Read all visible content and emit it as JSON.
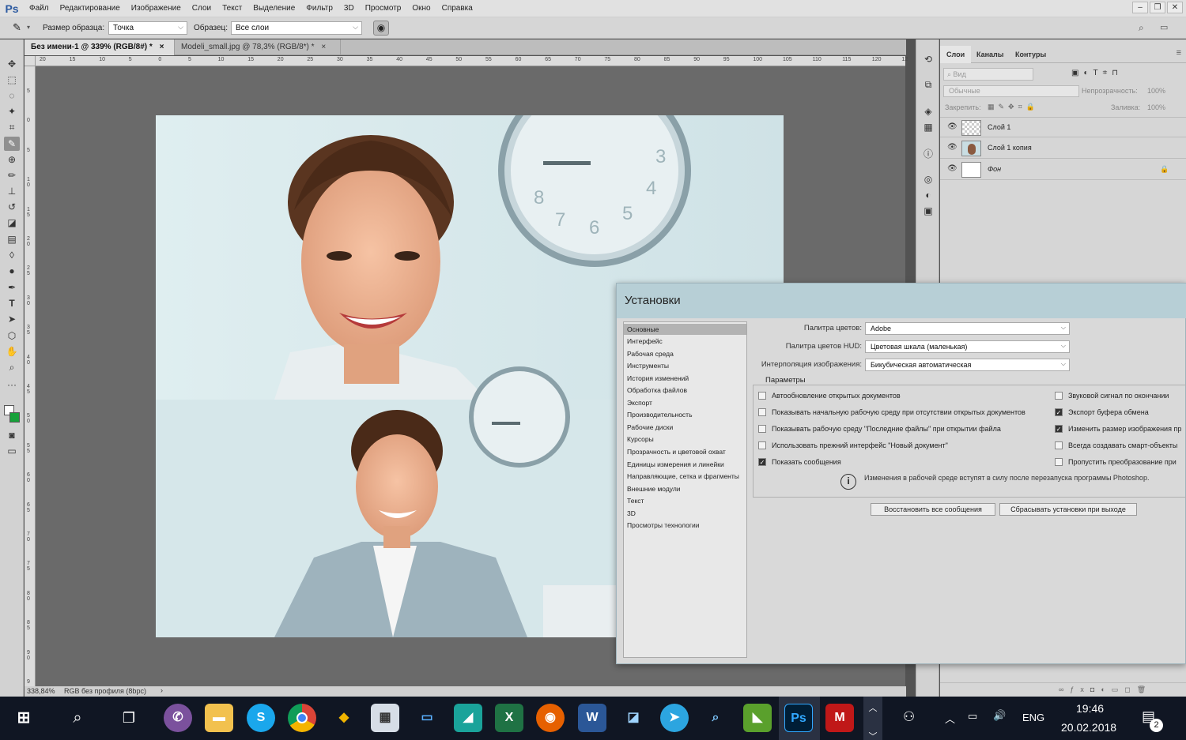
{
  "app": {
    "logo": "Ps"
  },
  "menu": [
    "Файл",
    "Редактирование",
    "Изображение",
    "Слои",
    "Текст",
    "Выделение",
    "Фильтр",
    "3D",
    "Просмотр",
    "Окно",
    "Справка"
  ],
  "options": {
    "sample_size_label": "Размер образца:",
    "sample_size_value": "Точка",
    "sample_label": "Образец:",
    "sample_value": "Все слои"
  },
  "tabs": [
    {
      "label": "Без имени-1 @ 339% (RGB/8#) *",
      "close": "×"
    },
    {
      "label": "Modeli_small.jpg @ 78,3% (RGB/8*) *",
      "close": "×"
    }
  ],
  "ruler_top": [
    "20",
    "15",
    "10",
    "5",
    "0",
    "5",
    "10",
    "15",
    "20",
    "25",
    "30",
    "35",
    "40",
    "45",
    "50",
    "55",
    "60",
    "65",
    "70",
    "75",
    "80",
    "85",
    "90",
    "95",
    "100",
    "105",
    "110",
    "115",
    "120",
    "12"
  ],
  "ruler_left": [
    "5",
    "0",
    "5",
    "1 0",
    "1 5",
    "2 0",
    "2 5",
    "3 0",
    "3 5",
    "4 0",
    "4 5",
    "5 0",
    "5 5",
    "6 0",
    "6 5",
    "7 0",
    "7 5",
    "8 0",
    "8 5",
    "9 0",
    "9"
  ],
  "status": {
    "zoom": "338,84%",
    "profile": "RGB без профиля (8bpc)"
  },
  "layers_panel": {
    "tabs": [
      "Слои",
      "Каналы",
      "Контуры"
    ],
    "filter_label": "Вид",
    "blend_mode": "Обычные",
    "opacity_label": "Непрозрачность:",
    "opacity_value": "100%",
    "lock_label": "Закрепить:",
    "fill_label": "Заливка:",
    "fill_value": "100%",
    "layers": [
      {
        "name": "Слой 1",
        "visible": true
      },
      {
        "name": "Слой 1 копия",
        "visible": true
      },
      {
        "name": "Фон",
        "visible": true,
        "locked": true
      }
    ]
  },
  "prefs": {
    "title": "Установки",
    "nav": [
      "Основные",
      "Интерфейс",
      "Рабочая среда",
      "Инструменты",
      "История изменений",
      "Обработка файлов",
      "Экспорт",
      "Производительность",
      "Рабочие диски",
      "Курсоры",
      "Прозрачность и цветовой охват",
      "Единицы измерения и линейки",
      "Направляющие, сетка и фрагменты",
      "Внешние модули",
      "Текст",
      "3D",
      "Просмотры технологии"
    ],
    "selected_nav": "Основные",
    "color_picker_label": "Палитра цветов:",
    "color_picker_value": "Adobe",
    "hud_picker_label": "Палитра цветов HUD:",
    "hud_picker_value": "Цветовая шкала (маленькая)",
    "interp_label": "Интерполяция изображения:",
    "interp_value": "Бикубическая автоматическая",
    "params_title": "Параметры",
    "checks_left": [
      {
        "label": "Автообновление открытых документов",
        "checked": false
      },
      {
        "label": "Показывать начальную рабочую среду при отсутствии открытых документов",
        "checked": false
      },
      {
        "label": "Показывать рабочую среду \"Последние файлы\" при открытии файла",
        "checked": false
      },
      {
        "label": "Использовать прежний интерфейс \"Новый документ\"",
        "checked": false
      },
      {
        "label": "Показать сообщения",
        "checked": true
      }
    ],
    "checks_right": [
      {
        "label": "Звуковой сигнал по окончании",
        "checked": false
      },
      {
        "label": "Экспорт буфера обмена",
        "checked": true
      },
      {
        "label": "Изменить размер изображения пр",
        "checked": true
      },
      {
        "label": "Всегда создавать смарт-объекты",
        "checked": false
      },
      {
        "label": "Пропустить преобразование при",
        "checked": false
      }
    ],
    "note": "Изменения в рабочей среде вступят в силу после перезапуска программы Photoshop.",
    "btn_restore": "Восстановить все сообщения",
    "btn_reset": "Сбрасывать установки при выходе"
  },
  "taskbar": {
    "lang": "ENG",
    "time": "19:46",
    "date": "20.02.2018",
    "notif_count": "2"
  }
}
